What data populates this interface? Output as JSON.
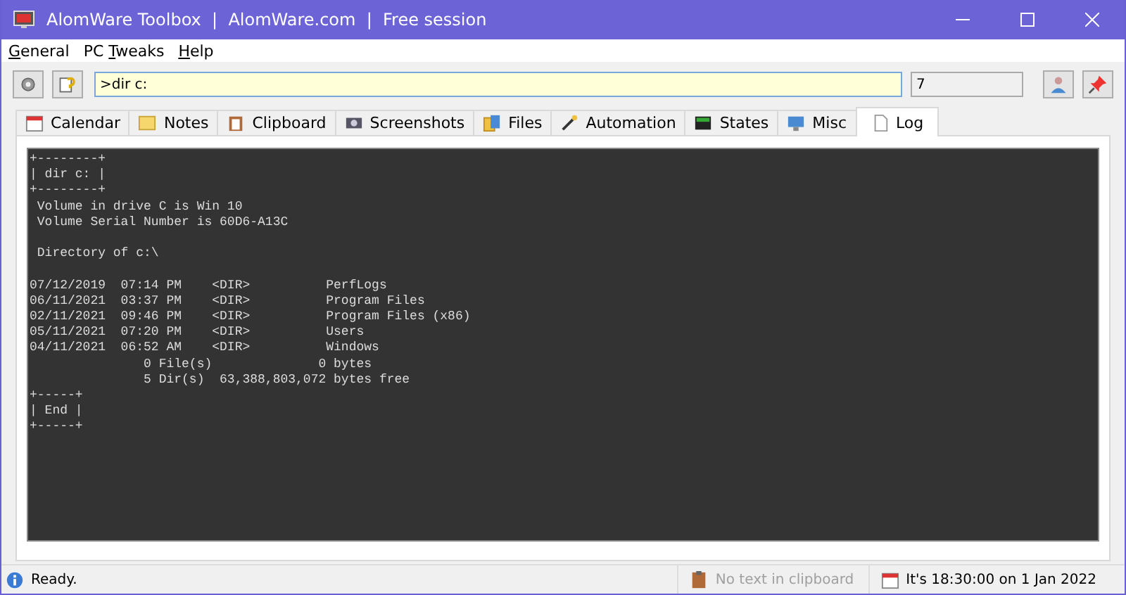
{
  "window": {
    "title": "AlomWare Toolbox  |  AlomWare.com  |  Free session"
  },
  "menu": [
    {
      "access_key": "G",
      "rest": "eneral"
    },
    {
      "before": "PC ",
      "access_key": "T",
      "rest": "weaks"
    },
    {
      "access_key": "H",
      "rest": "elp"
    }
  ],
  "command": {
    "value": ">dir c:"
  },
  "count": {
    "value": "7"
  },
  "tabs": [
    {
      "label": "Calendar",
      "selected": false
    },
    {
      "label": "Notes",
      "selected": false
    },
    {
      "label": "Clipboard",
      "selected": false
    },
    {
      "label": "Screenshots",
      "selected": false
    },
    {
      "label": "Files",
      "selected": false
    },
    {
      "label": "Automation",
      "selected": false
    },
    {
      "label": "States",
      "selected": false
    },
    {
      "label": "Misc",
      "selected": false
    },
    {
      "label": "Log",
      "selected": true
    }
  ],
  "log": [
    "+--------+",
    "| dir c: |",
    "+--------+",
    " Volume in drive C is Win 10",
    " Volume Serial Number is 60D6-A13C",
    {
      "text": " Directory of c:\\",
      "blank_line_before": true
    },
    {
      "text": "07/12/2019  07:14 PM    <DIR>          PerfLogs",
      "blank_line_before": true
    },
    "06/11/2021  03:37 PM    <DIR>          Program Files",
    "02/11/2021  09:46 PM    <DIR>          Program Files (x86)",
    "05/11/2021  07:20 PM    <DIR>          Users",
    "04/11/2021  06:52 AM    <DIR>          Windows",
    "               0 File(s)              0 bytes",
    "               5 Dir(s)  63,388,803,072 bytes free",
    "+-----+",
    "| End |",
    "+-----+"
  ],
  "status_bar": {
    "message": "Ready.",
    "clipboard": "No text in clipboard",
    "clock": "It's 18:30:00 on 1 Jan 2022"
  }
}
